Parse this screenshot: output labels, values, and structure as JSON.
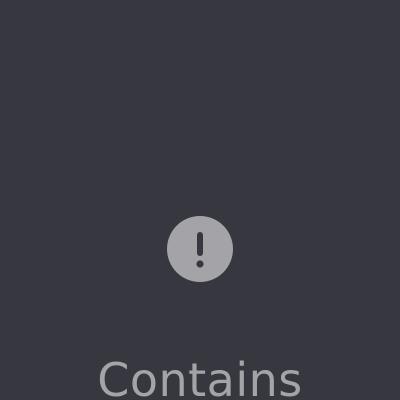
{
  "screen": {
    "background_color": "#37373f",
    "status_icon": "exclamation-circle-icon",
    "message": "Contains",
    "icon_color": "#a3a3a8",
    "text_color": "#a3a3a8"
  }
}
